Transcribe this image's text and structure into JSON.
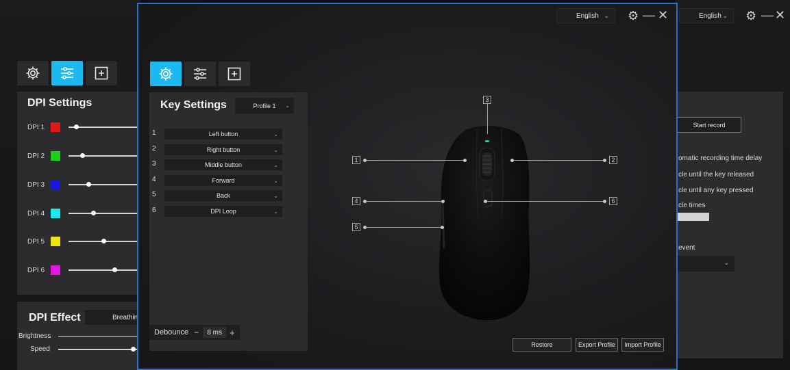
{
  "window": {
    "language": "English",
    "controls": {
      "settings": "gear-icon",
      "minimize": "minus-icon",
      "close": "close-icon"
    }
  },
  "left_panel": {
    "dpi_title": "DPI Settings",
    "dpi_levels": [
      {
        "label": "DPI 1",
        "color": "#e01818",
        "level": 0.08
      },
      {
        "label": "DPI 2",
        "color": "#18d018",
        "level": 0.17
      },
      {
        "label": "DPI 3",
        "color": "#1818d8",
        "level": 0.26
      },
      {
        "label": "DPI 4",
        "color": "#20e8e8",
        "level": 0.33
      },
      {
        "label": "DPI 5",
        "color": "#f0e010",
        "level": 0.48
      },
      {
        "label": "DPI 6",
        "color": "#e018e0",
        "level": 0.64
      }
    ],
    "dpi_effect_title": "DPI Effect",
    "dpi_effect_mode": "Breathing",
    "brightness_label": "Brightness",
    "brightness_level": 0.0,
    "speed_label": "Speed",
    "speed_level": 0.95
  },
  "key_settings": {
    "title": "Key Settings",
    "profile": "Profile 1",
    "keys": [
      {
        "num": "1",
        "action": "Left button"
      },
      {
        "num": "2",
        "action": "Right button"
      },
      {
        "num": "3",
        "action": "Middle button"
      },
      {
        "num": "4",
        "action": "Forward"
      },
      {
        "num": "5",
        "action": "Back"
      },
      {
        "num": "6",
        "action": "DPI Loop"
      }
    ],
    "debounce_label": "Debounce",
    "debounce_value": "8 ms"
  },
  "callouts": [
    "1",
    "2",
    "3",
    "4",
    "5",
    "6"
  ],
  "bottom_buttons": {
    "restore": "Restore",
    "export": "Export Profile",
    "import": "Import Profile"
  },
  "right_panel": {
    "start_record": "Start record",
    "opt_delay": "omatic recording time delay",
    "opt_until_release": "cle until the key released",
    "opt_until_pressed": "cle until any key pressed",
    "opt_times": "cle times",
    "event_label": "event"
  }
}
